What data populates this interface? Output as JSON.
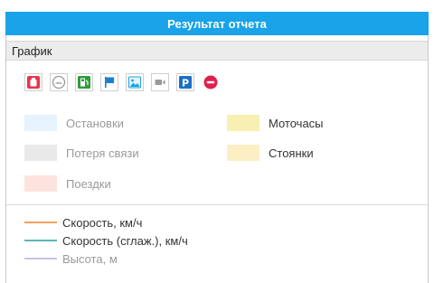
{
  "window": {
    "title": "Результат отчета"
  },
  "section": {
    "title": "График"
  },
  "toolbar": {
    "buttons": [
      {
        "icon": "fuel-tank-icon",
        "color": "#e8344e"
      },
      {
        "icon": "gauge-icon",
        "color": "#9a9a9a"
      },
      {
        "icon": "fuel-station-icon",
        "color": "#2e9c3a"
      },
      {
        "icon": "flag-icon",
        "color": "#1a7fd4"
      },
      {
        "icon": "image-icon",
        "color": "#1aa3e8"
      },
      {
        "icon": "video-icon",
        "color": "#9a9a9a"
      },
      {
        "icon": "parking-icon",
        "color": "#1a6fc7"
      },
      {
        "icon": "minus-circle-icon",
        "color": "#e0204a"
      }
    ]
  },
  "area_legend": {
    "items": [
      {
        "label": "Остановки",
        "color": "#e6f3fd",
        "muted": true
      },
      {
        "label": "Потеря связи",
        "color": "#e9e9e9",
        "muted": true
      },
      {
        "label": "Поездки",
        "color": "#fde3dd",
        "muted": true
      },
      {
        "label": "Моточасы",
        "color": "#f7f0b2",
        "muted": false
      },
      {
        "label": "Стоянки",
        "color": "#fcefc4",
        "muted": false
      }
    ]
  },
  "line_legend": {
    "items": [
      {
        "label": "Скорость, км/ч",
        "color": "#f2a15e",
        "muted": false
      },
      {
        "label": "Скорость (сглаж.), км/ч",
        "color": "#5ab8b3",
        "muted": false
      },
      {
        "label": "Высота, м",
        "color": "#c7c3e6",
        "muted": true
      }
    ]
  }
}
